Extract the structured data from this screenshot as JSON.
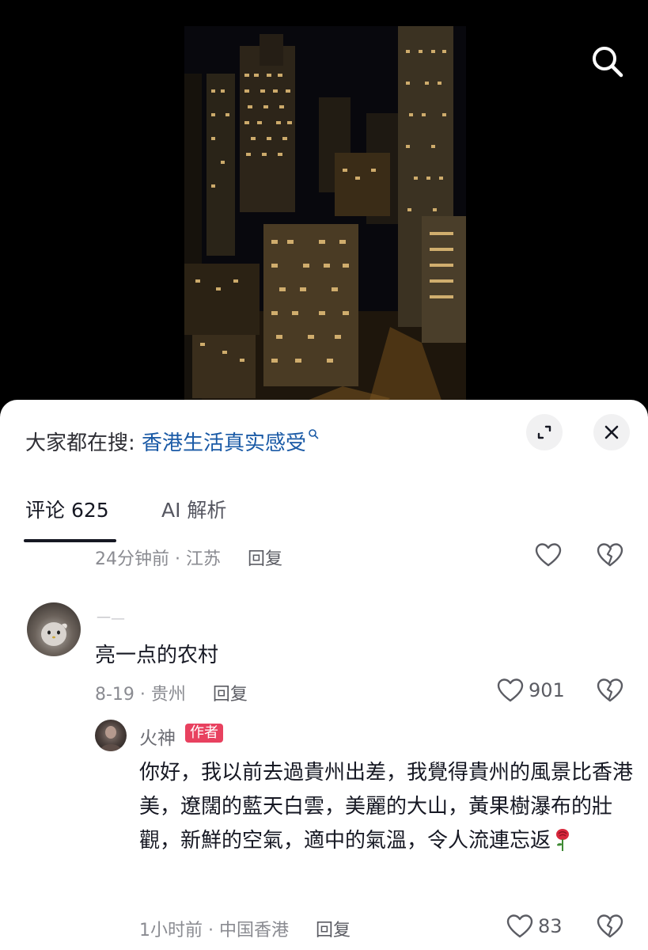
{
  "sheet": {
    "trending_prefix": "大家都在搜: ",
    "trending_term": "香港生活真实感受"
  },
  "tabs": [
    {
      "label": "评论 625",
      "active": true
    },
    {
      "label": "AI 解析",
      "active": false
    }
  ],
  "comments": [
    {
      "meta": "24分钟前 · 江苏",
      "reply_label": "回复"
    },
    {
      "username": "一—",
      "text": "亮一点的农村",
      "meta": "8-19 · 贵州",
      "reply_label": "回复",
      "likes": "901",
      "replies": [
        {
          "username": "火神",
          "badge": "作者",
          "text": "你好，我以前去過貴州出差，我覺得貴州的風景比香港美，遼闊的藍天白雲，美麗的大山，黃果樹瀑布的壯觀，新鮮的空氣，適中的氣溫，令人流連忘返",
          "emoji": "rose-icon",
          "meta": "1小时前 · 中国香港",
          "reply_label": "回复",
          "likes": "83"
        }
      ]
    }
  ],
  "colors": {
    "accent_link": "#1a5aa6",
    "author_badge": "#e8415f",
    "tab_underline": "#161823"
  }
}
